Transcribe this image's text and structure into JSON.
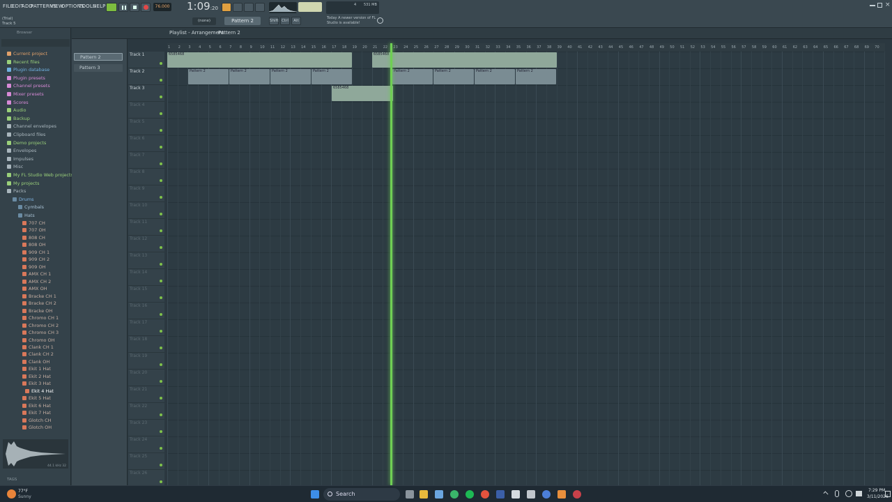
{
  "menu": [
    "FILE",
    "EDIT",
    "ADD",
    "PATTERNS",
    "VIEW",
    "OPTIONS",
    "TOOLS",
    "HELP"
  ],
  "transport": {
    "tempo": "76.000",
    "time_main": "1:09",
    "time_sub": "20"
  },
  "hint_panel": {
    "line1": "(Trial)",
    "line2": "Track 5"
  },
  "pattern_selector": "Pattern 2",
  "none_label": "(none)",
  "mod_keys": [
    "Shift",
    "Ctrl",
    "Alt"
  ],
  "news": {
    "date": "Today",
    "text": "A newer version of FL Studio is available!"
  },
  "memory": {
    "value": "531 MB",
    "cpu": "4"
  },
  "browser": {
    "title": "Browser",
    "items": [
      {
        "label": "Current project",
        "color": "#e0a06a"
      },
      {
        "label": "Recent files",
        "color": "#9ad07a"
      },
      {
        "label": "Plugin database",
        "color": "#6fb0e0"
      },
      {
        "label": "Plugin presets",
        "color": "#d68ad6"
      },
      {
        "label": "Channel presets",
        "color": "#d68ad6"
      },
      {
        "label": "Mixer presets",
        "color": "#d68ad6"
      },
      {
        "label": "Scores",
        "color": "#d68ad6"
      },
      {
        "label": "Audio",
        "color": "#9ad07a"
      },
      {
        "label": "Backup",
        "color": "#9ad07a"
      },
      {
        "label": "Channel envelopes",
        "color": "#a9b6bd"
      },
      {
        "label": "Clipboard files",
        "color": "#a9b6bd"
      },
      {
        "label": "Demo projects",
        "color": "#9ad07a"
      },
      {
        "label": "Envelopes",
        "color": "#a9b6bd"
      },
      {
        "label": "Impulses",
        "color": "#a9b6bd"
      },
      {
        "label": "Misc",
        "color": "#a9b6bd"
      },
      {
        "label": "My FL Studio Web projects",
        "color": "#9ad07a"
      },
      {
        "label": "My projects",
        "color": "#9ad07a"
      },
      {
        "label": "Packs",
        "color": "#a9b6bd"
      }
    ],
    "folders": {
      "drums": "Drums",
      "cymbals": "Cymbals",
      "hats": "Hats"
    },
    "files": [
      "707 CH",
      "707 OH",
      "808 CH",
      "808 OH",
      "909 CH 1",
      "909 CH 2",
      "909 OH",
      "AMX CH 1",
      "AMX CH 2",
      "AMX OH",
      "Bracke CH 1",
      "Bracke CH 2",
      "Bracke OH",
      "Chromo CH 1",
      "Chromo CH 2",
      "Chromo CH 3",
      "Chromo OH",
      "Clank CH 1",
      "Clank CH 2",
      "Clank OH",
      "Ekit 1 Hat",
      "Ekit 2 Hat",
      "Ekit 3 Hat",
      "Ekit 4 Hat",
      "Ekit 5 Hat",
      "Ekit 6 Hat",
      "Ekit 7 Hat",
      "Glotch CH",
      "Glotch OH"
    ],
    "selected_file": "Ekit 4 Hat",
    "preview_info": "44.1 kHz 32",
    "tags": "TAGS"
  },
  "playlist": {
    "title": "Playlist - Arrangement",
    "pattern": "Pattern 2",
    "patterns": [
      "Pattern 2",
      "Pattern 3"
    ],
    "tracks": [
      "Track 1",
      "Track 2",
      "Track 3",
      "Track 4",
      "Track 5",
      "Track 6",
      "Track 7",
      "Track 8",
      "Track 9",
      "Track 10",
      "Track 11",
      "Track 12",
      "Track 13",
      "Track 14",
      "Track 15",
      "Track 16",
      "Track 17",
      "Track 18",
      "Track 19",
      "Track 20",
      "Track 21",
      "Track 22",
      "Track 23",
      "Track 24",
      "Track 25",
      "Track 26"
    ],
    "ruler": [
      "1",
      "2",
      "3",
      "4",
      "5",
      "6",
      "7",
      "8",
      "9",
      "10",
      "11",
      "12",
      "13",
      "14",
      "15",
      "16",
      "17",
      "18",
      "19",
      "20",
      "21",
      "22",
      "23",
      "24",
      "25",
      "26",
      "27",
      "28",
      "29",
      "30",
      "31",
      "32",
      "33",
      "34",
      "35",
      "36",
      "37",
      "38",
      "39",
      "40",
      "41",
      "42",
      "43",
      "44",
      "45",
      "46",
      "47",
      "48",
      "49",
      "50",
      "51",
      "52",
      "53",
      "54",
      "55",
      "56",
      "57",
      "58",
      "59",
      "60",
      "61",
      "62",
      "63",
      "64",
      "65",
      "66",
      "67",
      "68",
      "69",
      "70"
    ],
    "clip_audio_label": "6585468",
    "clip_pattern_label": "Pattern 2"
  },
  "taskbar": {
    "weather_temp": "77°F",
    "weather_desc": "Sunny",
    "search": "Search",
    "time": "7:29 PM",
    "date": "3/11/2026"
  }
}
